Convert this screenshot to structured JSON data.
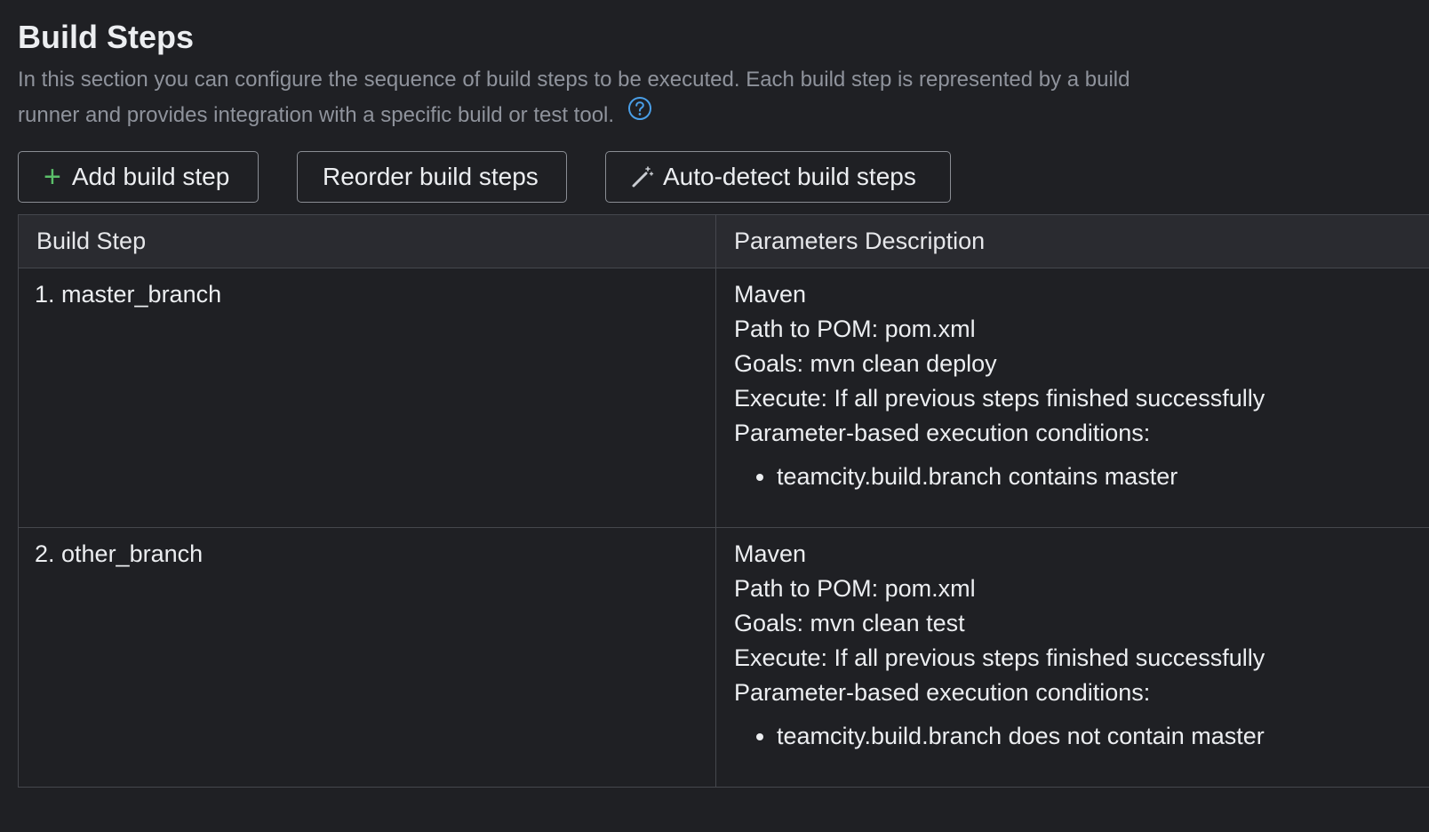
{
  "section": {
    "title": "Build Steps",
    "description": "In this section you can configure the sequence of build steps to be executed. Each build step is represented by a build runner and provides integration with a specific build or test tool.",
    "help_icon": "question-circle-icon"
  },
  "toolbar": {
    "add_icon": "plus-icon",
    "add_label": "Add build step",
    "reorder_label": "Reorder build steps",
    "autodetect_icon": "magic-wand-icon",
    "autodetect_label": "Auto-detect build steps"
  },
  "table": {
    "headers": [
      "Build Step",
      "Parameters Description"
    ],
    "rows": [
      {
        "step": "1. master_branch",
        "runner": "Maven",
        "path": "Path to POM: pom.xml",
        "goals": "Goals: mvn clean deploy",
        "execute": "Execute: If all previous steps finished successfully",
        "conditions_label": "Parameter-based execution conditions:",
        "conditions": [
          "teamcity.build.branch contains master"
        ]
      },
      {
        "step": "2. other_branch",
        "runner": "Maven",
        "path": "Path to POM: pom.xml",
        "goals": "Goals: mvn clean test",
        "execute": "Execute: If all previous steps finished successfully",
        "conditions_label": "Parameter-based execution conditions:",
        "conditions": [
          "teamcity.build.branch does not contain master"
        ]
      }
    ]
  },
  "colors": {
    "background": "#1f2024",
    "header_bg": "#2a2b30",
    "border": "#45474d",
    "muted_text": "#8f939c",
    "accent_green": "#5bbf6a",
    "help_blue": "#4a9fe8"
  }
}
